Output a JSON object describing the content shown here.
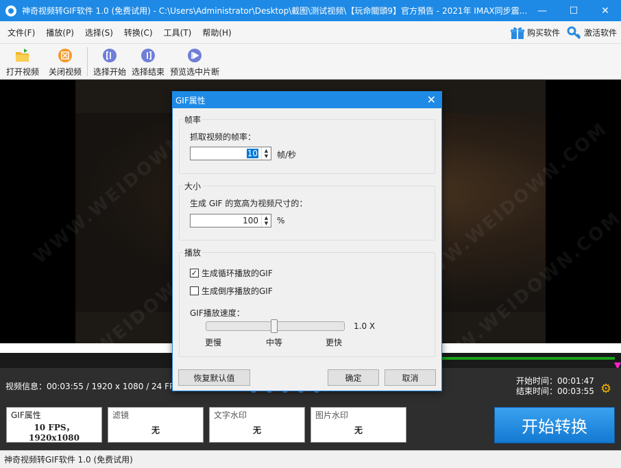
{
  "window": {
    "title": "神奇视频转GIF软件 1.0 (免费试用) - C:\\Users\\Administrator\\Desktop\\截图\\测试视频\\【玩命關頭9】官方預告 - 2021年 IMAX同步震...",
    "minimize": "—",
    "maximize": "☐",
    "close": "✕"
  },
  "menu": {
    "items": [
      "文件(F)",
      "播放(P)",
      "选择(S)",
      "转换(C)",
      "工具(T)",
      "帮助(H)"
    ],
    "buy": "购买软件",
    "activate": "激活软件"
  },
  "toolbar": {
    "open_video": "打开视频",
    "close_video": "关闭视频",
    "select_start": "选择开始",
    "select_end": "选择结束",
    "preview_selection": "预览选中片断"
  },
  "video": {
    "watermark": "WWW.WEIDOWN.COM"
  },
  "info": {
    "video_info": "视频信息：00:03:55 / 1920 x 1080 / 24 FPS",
    "start_time": "开始时间：00:01:47",
    "end_time": "结束时间：00:03:55"
  },
  "cards": {
    "gif": {
      "title": "GIF属性",
      "value_line1": "10 FPS，",
      "value_line2": "1920x1080"
    },
    "filter": {
      "title": "滤镜",
      "value": "无"
    },
    "text_watermark": {
      "title": "文字水印",
      "value": "无"
    },
    "image_watermark": {
      "title": "图片水印",
      "value": "无"
    }
  },
  "start_button": "开始转换",
  "status": "神奇视频转GIF软件 1.0 (免费试用)",
  "dialog": {
    "title": "GIF属性",
    "close": "✕",
    "framerate": {
      "group": "帧率",
      "label": "抓取视频的帧率：",
      "value": "10",
      "unit": "帧/秒"
    },
    "size": {
      "group": "大小",
      "label": "生成 GIF 的宽高为视频尺寸的：",
      "value": "100",
      "unit": "%"
    },
    "playback": {
      "group": "播放",
      "loop_label": "生成循环播放的GIF",
      "loop_checked": true,
      "reverse_label": "生成倒序播放的GIF",
      "reverse_checked": false,
      "speed_label": "GIF播放速度：",
      "speed_value": "1.0 X",
      "speed_fraction": 0.5,
      "slower": "更慢",
      "medium": "中等",
      "faster": "更快"
    },
    "buttons": {
      "restore_defaults": "恢复默认值",
      "ok": "确定",
      "cancel": "取消"
    }
  }
}
